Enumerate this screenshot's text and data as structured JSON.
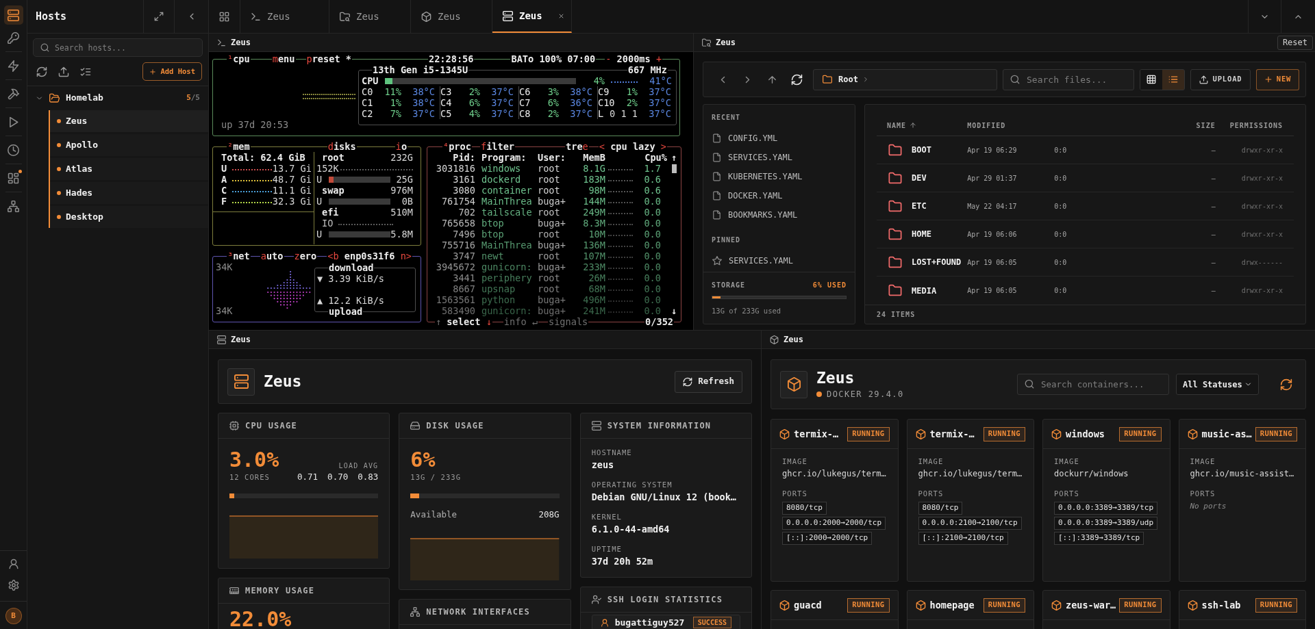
{
  "rail": {
    "items": [
      {
        "kind": "server",
        "selected": true,
        "badge": false
      },
      {
        "kind": "key",
        "selected": false,
        "badge": false
      },
      {
        "kind": "bolt",
        "selected": false,
        "badge": false
      },
      {
        "kind": "hammer",
        "selected": false,
        "badge": false
      },
      {
        "kind": "play",
        "selected": false,
        "badge": false
      },
      {
        "kind": "clock",
        "selected": false,
        "badge": false
      },
      {
        "kind": "layout",
        "selected": false,
        "badge": true
      },
      {
        "kind": "network",
        "selected": false,
        "badge": false
      }
    ],
    "footer": [
      {
        "kind": "user"
      },
      {
        "kind": "settings"
      }
    ],
    "avatar": "B"
  },
  "sidebar": {
    "title": "Hosts",
    "search": {
      "placeholder": "Search hosts..."
    },
    "add_button": "Add Host",
    "groups": [
      {
        "name": "Homelab",
        "expanded": true,
        "count": "5",
        "total": "/5",
        "hosts": [
          {
            "name": "Zeus",
            "selected": true
          },
          {
            "name": "Apollo",
            "selected": false
          },
          {
            "name": "Atlas",
            "selected": false
          },
          {
            "name": "Hades",
            "selected": false
          },
          {
            "name": "Desktop",
            "selected": false
          }
        ]
      }
    ]
  },
  "tabs": [
    {
      "kind": "terminal",
      "label": "Zeus",
      "selected": false
    },
    {
      "kind": "files",
      "label": "Zeus",
      "selected": false
    },
    {
      "kind": "docker",
      "label": "Zeus",
      "selected": false
    },
    {
      "kind": "server",
      "label": "Zeus",
      "selected": true
    }
  ],
  "terminal": {
    "title": "Zeus",
    "cpu": {
      "titles": [
        [
          {
            "t": "¹",
            "kind": "hot"
          },
          {
            "t": "cpu",
            "kind": "text"
          }
        ],
        [
          {
            "t": "m",
            "kind": "hot"
          },
          {
            "t": "enu",
            "kind": "text"
          }
        ],
        [
          {
            "t": "p",
            "kind": "hot"
          },
          {
            "t": "reset *",
            "kind": "text"
          }
        ],
        [
          {
            "t": "22:28:56",
            "kind": "text"
          }
        ],
        [
          {
            "t": "BATo 100% 07:00",
            "kind": "text"
          }
        ],
        [
          {
            "t": "-",
            "kind": "hot"
          },
          {
            "t": " 2000ms ",
            "kind": "text"
          },
          {
            "t": "+",
            "kind": "hot"
          }
        ]
      ],
      "uptime": "up 37d 20:53",
      "model": "13th Gen i5-1345U",
      "freq": "667 MHz",
      "total": {
        "name": "CPU",
        "load": "4%",
        "temp": "41°C",
        "level": 0.04
      },
      "cores": [
        {
          "kind": "core",
          "name": "C0",
          "load": "11%",
          "temp": "38°C"
        },
        {
          "kind": "core",
          "name": "C3",
          "load": "2%",
          "temp": "37°C"
        },
        {
          "kind": "core",
          "name": "C6",
          "load": "3%",
          "temp": "38°C"
        },
        {
          "kind": "core",
          "name": "C9",
          "load": "1%",
          "temp": "37°C"
        },
        {
          "kind": "core",
          "name": "C1",
          "load": "1%",
          "temp": "38°C"
        },
        {
          "kind": "core",
          "name": "C4",
          "load": "6%",
          "temp": "37°C"
        },
        {
          "kind": "core",
          "name": "C7",
          "load": "6%",
          "temp": "36°C"
        },
        {
          "kind": "core",
          "name": "C10",
          "load": "2%",
          "temp": "37°C"
        },
        {
          "kind": "core",
          "name": "C2",
          "load": "7%",
          "temp": "37°C"
        },
        {
          "kind": "core",
          "name": "C5",
          "load": "4%",
          "temp": "37°C"
        },
        {
          "kind": "core",
          "name": "C8",
          "load": "2%",
          "temp": "37°C"
        },
        {
          "kind": "load",
          "name": "L",
          "load": "0 1 1",
          "temp": "37°C"
        }
      ]
    },
    "mem": {
      "title": [
        {
          "t": "²",
          "kind": "hot"
        },
        {
          "t": "mem",
          "kind": "text"
        }
      ],
      "total": "Total: 62.4 GiB",
      "rows": [
        {
          "label": "U",
          "value": "13.7 Gi",
          "color": "#c84b4b"
        },
        {
          "label": "A",
          "value": "48.7 Gi",
          "color": "#e0c23a"
        },
        {
          "label": "C",
          "value": "11.1 Gi",
          "color": "#4a9fd8"
        },
        {
          "label": "F",
          "value": "32.3 Gi",
          "color": "#b5d84a"
        }
      ]
    },
    "disks": {
      "titles": [
        [
          {
            "t": "d",
            "kind": "hot"
          },
          {
            "t": "isks",
            "kind": "text"
          }
        ],
        [
          {
            "t": "i",
            "kind": "hot"
          },
          {
            "t": "o",
            "kind": "text"
          }
        ]
      ],
      "rows": [
        {
          "kind": "mount",
          "name": "root",
          "size": "232G"
        },
        {
          "kind": "rate",
          "label": "152K"
        },
        {
          "kind": "usage",
          "label": "U",
          "value": "25G",
          "level": 0.08
        },
        {
          "kind": "mount",
          "name": "swap",
          "size": "976M"
        },
        {
          "kind": "usage",
          "label": "U",
          "value": "0B",
          "level": 0
        },
        {
          "kind": "mount",
          "name": "efi",
          "size": "510M"
        },
        {
          "kind": "io",
          "label": "IO"
        },
        {
          "kind": "usage",
          "label": "U",
          "value": "5.8M",
          "level": 0
        }
      ]
    },
    "net": {
      "titles": [
        [
          {
            "t": "³",
            "kind": "hot"
          },
          {
            "t": "net",
            "kind": "text"
          }
        ],
        [
          {
            "t": "a",
            "kind": "hot"
          },
          {
            "t": "uto",
            "kind": "text"
          }
        ],
        [
          {
            "t": "z",
            "kind": "hot"
          },
          {
            "t": "ero",
            "kind": "text"
          }
        ],
        [
          {
            "t": "<b",
            "kind": "hot"
          },
          {
            "t": " enp0s31f6 ",
            "kind": "text"
          },
          {
            "t": "n>",
            "kind": "hot"
          }
        ]
      ],
      "scale_top": "34K",
      "scale_bottom": "34K",
      "download": {
        "title": "download",
        "arrow": "▼",
        "rate": "3.39 KiB/s"
      },
      "upload": {
        "title": "upload",
        "arrow": "▲",
        "rate": "12.2 KiB/s"
      }
    },
    "proc": {
      "titles": [
        [
          {
            "t": "⁴",
            "kind": "hot"
          },
          {
            "t": "proc",
            "kind": "text"
          }
        ],
        [
          {
            "t": "f",
            "kind": "hot"
          },
          {
            "t": "ilter",
            "kind": "text"
          }
        ],
        [
          {
            "t": "tre",
            "kind": "text"
          },
          {
            "t": "e",
            "kind": "hot"
          }
        ],
        [
          {
            "t": "<",
            "kind": "hot"
          },
          {
            "t": " cpu lazy ",
            "kind": "text"
          },
          {
            "t": ">",
            "kind": "hot"
          }
        ]
      ],
      "columns": [
        "Pid:",
        "Program:",
        "User:",
        "MemB",
        "Cpu%"
      ],
      "scroll_up": "↑",
      "scroll_down": "↓",
      "rows": [
        {
          "pid": "3031816",
          "program": "windows",
          "user": "root",
          "mem": "8.1G",
          "cpu": "1.7"
        },
        {
          "pid": "3161",
          "program": "dockerd",
          "user": "root",
          "mem": "183M",
          "cpu": "0.6"
        },
        {
          "pid": "3080",
          "program": "container",
          "user": "root",
          "mem": "98M",
          "cpu": "0.6"
        },
        {
          "pid": "761754",
          "program": "MainThrea",
          "user": "buga+",
          "mem": "144M",
          "cpu": "0.0"
        },
        {
          "pid": "702",
          "program": "tailscale",
          "user": "root",
          "mem": "249M",
          "cpu": "0.0"
        },
        {
          "pid": "765658",
          "program": "btop",
          "user": "buga+",
          "mem": "8.3M",
          "cpu": "0.0"
        },
        {
          "pid": "7496",
          "program": "btop",
          "user": "root",
          "mem": "10M",
          "cpu": "0.0"
        },
        {
          "pid": "755716",
          "program": "MainThrea",
          "user": "buga+",
          "mem": "136M",
          "cpu": "0.0"
        },
        {
          "pid": "3747",
          "program": "newt",
          "user": "root",
          "mem": "107M",
          "cpu": "0.0"
        },
        {
          "pid": "3945672",
          "program": "gunicorn:",
          "user": "buga+",
          "mem": "233M",
          "cpu": "0.0"
        },
        {
          "pid": "3441",
          "program": "periphery",
          "user": "root",
          "mem": "26M",
          "cpu": "0.0"
        },
        {
          "pid": "8667",
          "program": "upsnap",
          "user": "root",
          "mem": "68M",
          "cpu": "0.0"
        },
        {
          "pid": "1563561",
          "program": "python",
          "user": "buga+",
          "mem": "496M",
          "cpu": "0.0"
        },
        {
          "pid": "583490",
          "program": "gunicorn:",
          "user": "buga+",
          "mem": "241M",
          "cpu": "0.0"
        }
      ],
      "footer": [
        [
          {
            "t": "↑",
            "kind": "dim"
          },
          {
            "t": " select ",
            "kind": "text"
          },
          {
            "t": "↓",
            "kind": "hot"
          }
        ],
        [
          {
            "t": "info ↵",
            "kind": "dim"
          }
        ],
        [
          {
            "t": "signals",
            "kind": "dim"
          }
        ]
      ],
      "count": "0/352"
    }
  },
  "files": {
    "title": "Zeus",
    "reset": "Reset",
    "path": "Root",
    "search_placeholder": "Search files...",
    "views": [
      {
        "kind": "grid",
        "selected": false
      },
      {
        "kind": "list",
        "selected": true
      }
    ],
    "upload": "UPLOAD",
    "new": "NEW",
    "recent_title": "RECENT",
    "recent": [
      "CONFIG.YML",
      "SERVICES.YAML",
      "KUBERNETES.YAML",
      "DOCKER.YAML",
      "BOOKMARKS.YAML"
    ],
    "pinned_title": "PINNED",
    "pinned": [
      "SERVICES.YAML"
    ],
    "storage": {
      "label": "STORAGE",
      "used": "6% USED",
      "level": 0.06,
      "detail": "13G of 233G used"
    },
    "columns": [
      {
        "label": "NAME",
        "sorted": true
      },
      {
        "label": "MODIFIED",
        "sorted": false
      },
      {
        "label": "SIZE",
        "sorted": false
      },
      {
        "label": "PERMISSIONS",
        "sorted": false
      }
    ],
    "rows": [
      {
        "name": "BOOT",
        "modified": "Apr 19 06:29",
        "column_3": "0:0",
        "size": "–",
        "permissions": "drwxr-xr-x"
      },
      {
        "name": "DEV",
        "modified": "Apr 29 01:37",
        "column_3": "0:0",
        "size": "–",
        "permissions": "drwxr-xr-x"
      },
      {
        "name": "ETC",
        "modified": "May 22 04:17",
        "column_3": "0:0",
        "size": "–",
        "permissions": "drwxr-xr-x"
      },
      {
        "name": "HOME",
        "modified": "Apr 19 06:06",
        "column_3": "0:0",
        "size": "–",
        "permissions": "drwxr-xr-x"
      },
      {
        "name": "LOST+FOUND",
        "modified": "Apr 19 06:05",
        "column_3": "0:0",
        "size": "–",
        "permissions": "drwx------"
      },
      {
        "name": "MEDIA",
        "modified": "Apr 19 06:05",
        "column_3": "0:0",
        "size": "–",
        "permissions": "drwxr-xr-x"
      }
    ],
    "footer": "24 ITEMS"
  },
  "server": {
    "title": "Zeus",
    "name": "Zeus",
    "refresh": "Refresh",
    "cpu": {
      "title": "CPU USAGE",
      "value": "3.0%",
      "cores": "12 CORES",
      "load_label": "LOAD AVG",
      "load": [
        "0.71",
        "0.70",
        "0.83"
      ],
      "level": 0.03
    },
    "memory": {
      "title": "MEMORY USAGE",
      "value": "22.0%"
    },
    "disk": {
      "title": "DISK USAGE",
      "value": "6%",
      "detail": "13G / 233G",
      "level": 0.06,
      "available_label": "Available",
      "available": "208G"
    },
    "network": {
      "title": "NETWORK INTERFACES"
    },
    "system": {
      "title": "SYSTEM INFORMATION",
      "fields": [
        {
          "label": "HOSTNAME",
          "value": "zeus"
        },
        {
          "label": "OPERATING SYSTEM",
          "value": "Debian GNU/Linux 12 (book…"
        },
        {
          "label": "KERNEL",
          "value": "6.1.0-44-amd64"
        },
        {
          "label": "UPTIME",
          "value": "37d 20h 52m"
        }
      ]
    },
    "ssh": {
      "title": "SSH LOGIN STATISTICS",
      "entries": [
        {
          "user": "bugattiguy527",
          "status": "SUCCESS"
        }
      ]
    }
  },
  "docker": {
    "title": "Zeus",
    "name": "Zeus",
    "version": "DOCKER 29.4.0",
    "search_placeholder": "Search containers...",
    "status_filter": "All Statuses",
    "containers": [
      {
        "name": "termix-…",
        "status": "RUNNING",
        "image_label": "IMAGE",
        "image": "ghcr.io/lukegus/term…",
        "ports_label": "PORTS",
        "ports": [
          "8080/tcp",
          "0.0.0.0:2000→2000/tcp",
          "[::]:2000→2000/tcp"
        ]
      },
      {
        "name": "termix-…",
        "status": "RUNNING",
        "image_label": "IMAGE",
        "image": "ghcr.io/lukegus/term…",
        "ports_label": "PORTS",
        "ports": [
          "8080/tcp",
          "0.0.0.0:2100→2100/tcp",
          "[::]:2100→2100/tcp"
        ]
      },
      {
        "name": "windows",
        "status": "RUNNING",
        "image_label": "IMAGE",
        "image": "dockurr/windows",
        "ports_label": "PORTS",
        "ports": [
          "0.0.0.0:3389→3389/tcp",
          "0.0.0.0:3389→3389/udp",
          "[::]:3389→3389/tcp"
        ]
      },
      {
        "name": "music-as…",
        "status": "RUNNING",
        "image_label": "IMAGE",
        "image": "ghcr.io/music-assist…",
        "ports_label": "PORTS",
        "no_ports": "No ports"
      },
      {
        "name": "guacd",
        "status": "RUNNING"
      },
      {
        "name": "homepage",
        "status": "RUNNING"
      },
      {
        "name": "zeus-war…",
        "status": "RUNNING"
      },
      {
        "name": "ssh-lab",
        "status": "RUNNING"
      }
    ]
  }
}
